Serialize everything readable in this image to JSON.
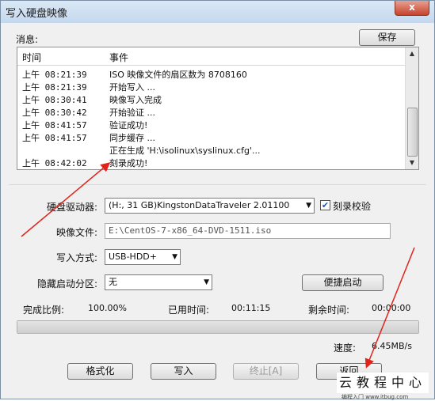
{
  "window": {
    "title": "写入硬盘映像",
    "close_label": "x"
  },
  "messages": {
    "label": "消息:",
    "save_label": "保存",
    "columns": [
      "时间",
      "事件"
    ],
    "rows": [
      {
        "time": "上午 08:21:39",
        "event": "ISO 映像文件的扇区数为 8708160"
      },
      {
        "time": "上午 08:21:39",
        "event": "开始写入 ..."
      },
      {
        "time": "上午 08:30:41",
        "event": "映像写入完成"
      },
      {
        "time": "上午 08:30:42",
        "event": "开始验证 ..."
      },
      {
        "time": "上午 08:41:57",
        "event": "验证成功!"
      },
      {
        "time": "上午 08:41:57",
        "event": "同步缓存 ..."
      },
      {
        "time": "",
        "event": "正在生成 'H:\\isolinux\\syslinux.cfg'..."
      },
      {
        "time": "上午 08:42:02",
        "event": "刻录成功!"
      }
    ]
  },
  "form": {
    "drive_label": "硬盘驱动器:",
    "drive_value": "(H:, 31 GB)KingstonDataTraveler 2.01100",
    "verify_label": "刻录校验",
    "verify_checked": true,
    "image_label": "映像文件:",
    "image_value": "E:\\CentOS-7-x86_64-DVD-1511.iso",
    "write_mode_label": "写入方式:",
    "write_mode_value": "USB-HDD+",
    "hidden_part_label": "隐藏启动分区:",
    "hidden_part_value": "无",
    "quick_boot_label": "便捷启动"
  },
  "status": {
    "complete_label": "完成比例:",
    "complete_value": "100.00%",
    "elapsed_label": "已用时间:",
    "elapsed_value": "00:11:15",
    "remaining_label": "剩余时间:",
    "remaining_value": "00:00:00",
    "progress_fraction": 1.0,
    "speed_label": "速度:",
    "speed_value": "6.45MB/s"
  },
  "buttons": {
    "format": "格式化",
    "write": "写入",
    "abort": "终止[A]",
    "back": "返回"
  },
  "watermark": {
    "text": "云教程中心",
    "small": "编程入门 www.itbug.com"
  }
}
